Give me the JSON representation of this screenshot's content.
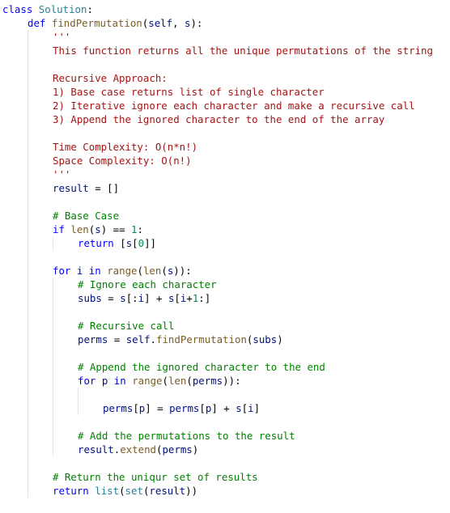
{
  "editor": {
    "lines": [
      {
        "indent": 0,
        "tokens": [
          [
            "kw",
            "class"
          ],
          [
            "plain",
            " "
          ],
          [
            "cls",
            "Solution"
          ],
          [
            "plain",
            ":"
          ]
        ]
      },
      {
        "indent": 1,
        "tokens": [
          [
            "kw",
            "def"
          ],
          [
            "plain",
            " "
          ],
          [
            "fn",
            "findPermutation"
          ],
          [
            "plain",
            "("
          ],
          [
            "id",
            "self"
          ],
          [
            "plain",
            ", "
          ],
          [
            "id",
            "s"
          ],
          [
            "plain",
            "):"
          ]
        ]
      },
      {
        "indent": 2,
        "tokens": [
          [
            "doc",
            "'''"
          ]
        ]
      },
      {
        "indent": 2,
        "tokens": [
          [
            "doc",
            "This function returns all the unique permutations of the string"
          ]
        ]
      },
      {
        "indent": 2,
        "tokens": []
      },
      {
        "indent": 2,
        "tokens": [
          [
            "doc",
            "Recursive Approach:"
          ]
        ]
      },
      {
        "indent": 2,
        "tokens": [
          [
            "doc",
            "1) Base case returns list of single character"
          ]
        ]
      },
      {
        "indent": 2,
        "tokens": [
          [
            "doc",
            "2) Iterative ignore each character and make a recursive call"
          ]
        ]
      },
      {
        "indent": 2,
        "tokens": [
          [
            "doc",
            "3) Append the ignored character to the end of the array"
          ]
        ]
      },
      {
        "indent": 2,
        "tokens": []
      },
      {
        "indent": 2,
        "tokens": [
          [
            "doc",
            "Time Complexity: O(n*n!)"
          ]
        ]
      },
      {
        "indent": 2,
        "tokens": [
          [
            "doc",
            "Space Complexity: O(n!)"
          ]
        ]
      },
      {
        "indent": 2,
        "tokens": [
          [
            "doc",
            "'''"
          ]
        ]
      },
      {
        "indent": 2,
        "tokens": [
          [
            "id",
            "result"
          ],
          [
            "plain",
            " = []"
          ]
        ]
      },
      {
        "indent": 2,
        "tokens": []
      },
      {
        "indent": 2,
        "tokens": [
          [
            "cmt",
            "# Base Case"
          ]
        ]
      },
      {
        "indent": 2,
        "tokens": [
          [
            "kw",
            "if"
          ],
          [
            "plain",
            " "
          ],
          [
            "fn",
            "len"
          ],
          [
            "plain",
            "("
          ],
          [
            "id",
            "s"
          ],
          [
            "plain",
            ") == "
          ],
          [
            "num",
            "1"
          ],
          [
            "plain",
            ":"
          ]
        ]
      },
      {
        "indent": 3,
        "tokens": [
          [
            "kw",
            "return"
          ],
          [
            "plain",
            " ["
          ],
          [
            "id",
            "s"
          ],
          [
            "plain",
            "["
          ],
          [
            "num",
            "0"
          ],
          [
            "plain",
            "]]"
          ]
        ]
      },
      {
        "indent": 2,
        "tokens": []
      },
      {
        "indent": 2,
        "tokens": [
          [
            "kw",
            "for"
          ],
          [
            "plain",
            " "
          ],
          [
            "id",
            "i"
          ],
          [
            "plain",
            " "
          ],
          [
            "kw",
            "in"
          ],
          [
            "plain",
            " "
          ],
          [
            "fn",
            "range"
          ],
          [
            "plain",
            "("
          ],
          [
            "fn",
            "len"
          ],
          [
            "plain",
            "("
          ],
          [
            "id",
            "s"
          ],
          [
            "plain",
            "))"
          ],
          [
            "plain",
            ":"
          ]
        ]
      },
      {
        "indent": 3,
        "tokens": [
          [
            "cmt",
            "# Ignore each character"
          ]
        ]
      },
      {
        "indent": 3,
        "tokens": [
          [
            "id",
            "subs"
          ],
          [
            "plain",
            " = "
          ],
          [
            "id",
            "s"
          ],
          [
            "plain",
            "[:"
          ],
          [
            "id",
            "i"
          ],
          [
            "plain",
            "] + "
          ],
          [
            "id",
            "s"
          ],
          [
            "plain",
            "["
          ],
          [
            "id",
            "i"
          ],
          [
            "plain",
            "+"
          ],
          [
            "num",
            "1"
          ],
          [
            "plain",
            ":]"
          ]
        ]
      },
      {
        "indent": 3,
        "tokens": []
      },
      {
        "indent": 3,
        "tokens": [
          [
            "cmt",
            "# Recursive call"
          ]
        ]
      },
      {
        "indent": 3,
        "tokens": [
          [
            "id",
            "perms"
          ],
          [
            "plain",
            " = "
          ],
          [
            "id",
            "self"
          ],
          [
            "plain",
            "."
          ],
          [
            "fn",
            "findPermutation"
          ],
          [
            "plain",
            "("
          ],
          [
            "id",
            "subs"
          ],
          [
            "plain",
            ")"
          ]
        ]
      },
      {
        "indent": 3,
        "tokens": []
      },
      {
        "indent": 3,
        "tokens": [
          [
            "cmt",
            "# Append the ignored character to the end"
          ]
        ]
      },
      {
        "indent": 3,
        "tokens": [
          [
            "kw",
            "for"
          ],
          [
            "plain",
            " "
          ],
          [
            "id",
            "p"
          ],
          [
            "plain",
            " "
          ],
          [
            "kw",
            "in"
          ],
          [
            "plain",
            " "
          ],
          [
            "fn",
            "range"
          ],
          [
            "plain",
            "("
          ],
          [
            "fn",
            "len"
          ],
          [
            "plain",
            "("
          ],
          [
            "id",
            "perms"
          ],
          [
            "plain",
            "))"
          ],
          [
            "plain",
            ":"
          ]
        ]
      },
      {
        "indent": 4,
        "tokens": []
      },
      {
        "indent": 4,
        "tokens": [
          [
            "id",
            "perms"
          ],
          [
            "plain",
            "["
          ],
          [
            "id",
            "p"
          ],
          [
            "plain",
            "] = "
          ],
          [
            "id",
            "perms"
          ],
          [
            "plain",
            "["
          ],
          [
            "id",
            "p"
          ],
          [
            "plain",
            "] + "
          ],
          [
            "id",
            "s"
          ],
          [
            "plain",
            "["
          ],
          [
            "id",
            "i"
          ],
          [
            "plain",
            "]"
          ]
        ]
      },
      {
        "indent": 3,
        "tokens": []
      },
      {
        "indent": 3,
        "tokens": [
          [
            "cmt",
            "# Add the permutations to the result"
          ]
        ]
      },
      {
        "indent": 3,
        "tokens": [
          [
            "id",
            "result"
          ],
          [
            "plain",
            "."
          ],
          [
            "fn",
            "extend"
          ],
          [
            "plain",
            "("
          ],
          [
            "id",
            "perms"
          ],
          [
            "plain",
            ")"
          ]
        ]
      },
      {
        "indent": 2,
        "tokens": []
      },
      {
        "indent": 2,
        "tokens": [
          [
            "cmt",
            "# Return the uniqur set of results"
          ]
        ]
      },
      {
        "indent": 2,
        "tokens": [
          [
            "kw",
            "return"
          ],
          [
            "plain",
            " "
          ],
          [
            "cls",
            "list"
          ],
          [
            "plain",
            "("
          ],
          [
            "cls",
            "set"
          ],
          [
            "plain",
            "("
          ],
          [
            "id",
            "result"
          ],
          [
            "plain",
            "))"
          ]
        ]
      }
    ]
  }
}
